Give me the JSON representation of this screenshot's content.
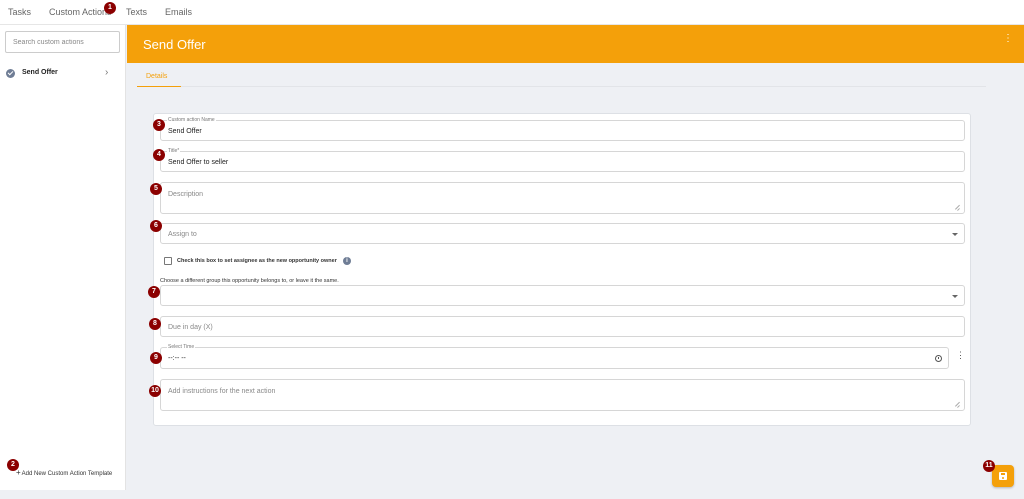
{
  "nav": {
    "tabs": [
      {
        "label": "Tasks"
      },
      {
        "label": "Custom Actions"
      },
      {
        "label": "Texts"
      },
      {
        "label": "Emails"
      }
    ]
  },
  "sidebar": {
    "search_placeholder": "Search custom actions",
    "items": [
      {
        "label": "Send Offer",
        "icon": "check-circle-icon"
      }
    ],
    "add_template_label": "Add New Custom Action Template"
  },
  "header": {
    "title": "Send Offer",
    "menu_icon": "kebab-menu-icon"
  },
  "tabs": [
    {
      "label": "Details"
    }
  ],
  "form": {
    "name": {
      "label": "Custom action Name",
      "value": "Send Offer"
    },
    "title": {
      "label": "Title*",
      "value": "Send Offer to seller"
    },
    "description": {
      "placeholder": "Description"
    },
    "assign_to": {
      "placeholder": "Assign to"
    },
    "owner_checkbox_label": "Check this box to set assignee as the new opportunity owner",
    "group_label": "Choose a different group this opportunity belongs to, or leave it the same.",
    "due_in_day": {
      "placeholder": "Due in day (X)"
    },
    "select_time": {
      "label": "Select Time",
      "value": "--:-- --"
    },
    "instructions": {
      "placeholder": "Add instructions for the next action"
    }
  },
  "markers": [
    "1",
    "2",
    "3",
    "4",
    "5",
    "6",
    "7",
    "8",
    "9",
    "10",
    "11"
  ],
  "colors": {
    "accent": "#f4a00a",
    "marker": "#8b0000",
    "background": "#eef0f4"
  }
}
